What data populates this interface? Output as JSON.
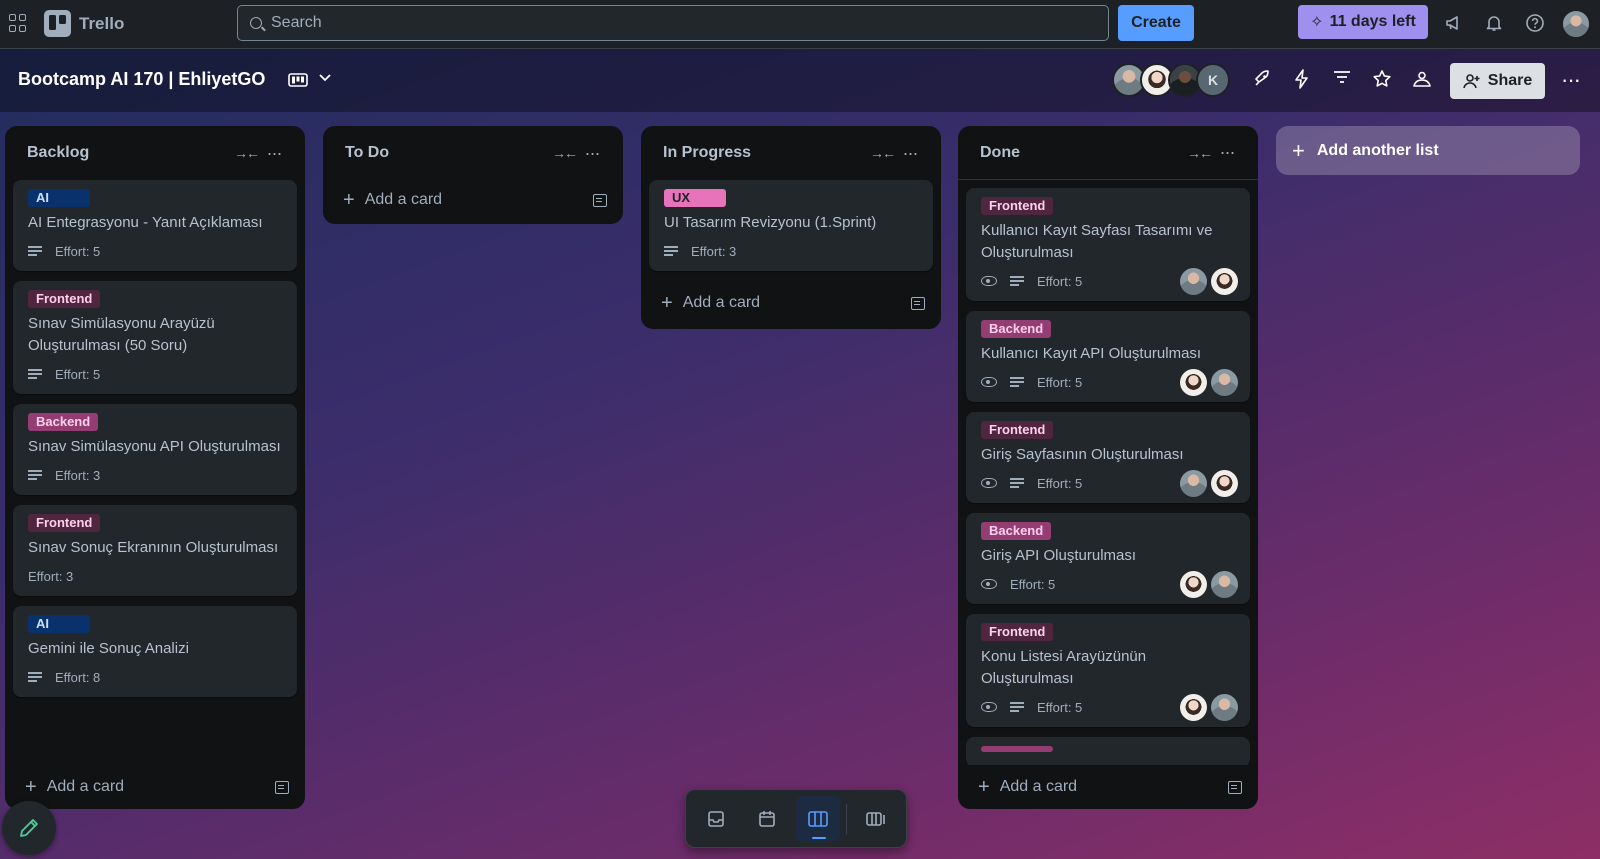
{
  "topbar": {
    "app_name": "Trello",
    "search_placeholder": "Search",
    "create_label": "Create",
    "trial_label": "11 days left"
  },
  "board": {
    "title": "Bootcamp AI 170 | EhliyetGO",
    "member_initial": "K",
    "share_label": "Share"
  },
  "lists": [
    {
      "title": "Backlog",
      "add_card_label": "Add a card",
      "cards": [
        {
          "label": "AI",
          "label_type": "ai",
          "title": "AI Entegrasyonu - Yanıt Açıklaması",
          "effort": "Effort: 5"
        },
        {
          "label": "Frontend",
          "label_type": "frontend",
          "title": "Sınav Simülasyonu Arayüzü Oluşturulması (50 Soru)",
          "effort": "Effort: 5"
        },
        {
          "label": "Backend",
          "label_type": "backend",
          "title": "Sınav Simülasyonu API Oluşturulması",
          "effort": "Effort: 3"
        },
        {
          "label": "Frontend",
          "label_type": "frontend",
          "title": "Sınav Sonuç Ekranının Oluşturulması",
          "effort": "Effort: 3"
        },
        {
          "label": "AI",
          "label_type": "ai",
          "title": "Gemini ile Sonuç Analizi",
          "effort": "Effort: 8"
        }
      ]
    },
    {
      "title": "To Do",
      "add_card_label": "Add a card",
      "cards": []
    },
    {
      "title": "In Progress",
      "add_card_label": "Add a card",
      "cards": [
        {
          "label": "UX",
          "label_type": "ux",
          "title": "UI Tasarım Revizyonu (1.Sprint)",
          "effort": "Effort: 3"
        }
      ]
    },
    {
      "title": "Done",
      "add_card_label": "Add a card",
      "cards": [
        {
          "label": "Frontend",
          "label_type": "frontend",
          "title": "Kullanıcı Kayıt Sayfası Tasarımı ve Oluşturulması",
          "effort": "Effort: 5"
        },
        {
          "label": "Backend",
          "label_type": "backend",
          "title": "Kullanıcı Kayıt API Oluşturulması",
          "effort": "Effort: 5"
        },
        {
          "label": "Frontend",
          "label_type": "frontend",
          "title": "Giriş Sayfasının Oluşturulması",
          "effort": "Effort: 5"
        },
        {
          "label": "Backend",
          "label_type": "backend",
          "title": "Giriş API Oluşturulması",
          "effort": "Effort: 5"
        },
        {
          "label": "Frontend",
          "label_type": "frontend",
          "title": "Konu Listesi Arayüzünün Oluşturulması",
          "effort": "Effort: 5"
        }
      ]
    }
  ],
  "add_list_label": "Add another list",
  "colors": {
    "accent": "#579dff",
    "trial": "#9f8fef",
    "list_bg": "#101214",
    "card_bg": "#22272b",
    "label_ai": "#09326c",
    "label_frontend": "#50253f",
    "label_backend": "#943d73",
    "label_ux": "#e774bb"
  },
  "icons": {
    "apps": "apps-grid-icon",
    "search": "search-icon",
    "notifications": "bell-icon",
    "help": "help-icon",
    "whats_new": "megaphone-icon",
    "board_view": "board-view-icon",
    "power_ups": "rocket-icon",
    "automation": "lightning-icon",
    "filter": "filter-icon",
    "star": "star-icon",
    "visibility": "people-icon",
    "view_inbox": "inbox-icon",
    "view_calendar": "calendar-icon",
    "view_board": "board-icon",
    "view_switch": "switch-boards-icon"
  }
}
